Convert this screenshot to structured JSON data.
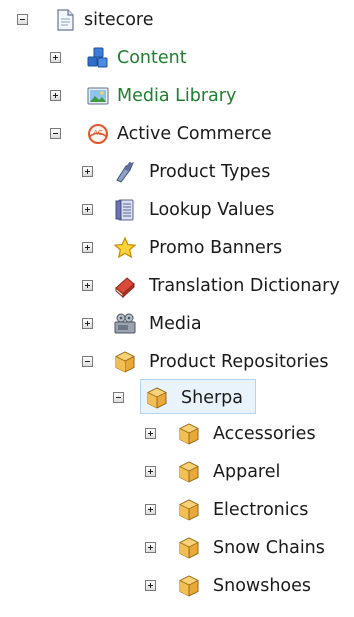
{
  "tree": {
    "root": {
      "label": "sitecore",
      "icon": "document-icon"
    },
    "items": [
      {
        "label": "Content",
        "icon": "content-icon",
        "state": "collapsed",
        "color": "#1f7f2e"
      },
      {
        "label": "Media Library",
        "icon": "media-library-icon",
        "state": "collapsed",
        "color": "#1f7f2e"
      },
      {
        "label": "Active Commerce",
        "icon": "active-commerce-icon",
        "state": "expanded"
      },
      {
        "label": "Product Types",
        "icon": "product-types-icon",
        "state": "collapsed"
      },
      {
        "label": "Lookup Values",
        "icon": "lookup-values-icon",
        "state": "collapsed"
      },
      {
        "label": "Promo Banners",
        "icon": "star-icon",
        "state": "collapsed"
      },
      {
        "label": "Translation Dictionary",
        "icon": "dictionary-book-icon",
        "state": "collapsed"
      },
      {
        "label": "Media",
        "icon": "media-icon",
        "state": "collapsed"
      },
      {
        "label": "Product Repositories",
        "icon": "box-icon",
        "state": "expanded"
      },
      {
        "label": "Sherpa",
        "icon": "box-icon",
        "state": "expanded",
        "selected": true
      },
      {
        "label": "Accessories",
        "icon": "box-icon",
        "state": "collapsed"
      },
      {
        "label": "Apparel",
        "icon": "box-icon",
        "state": "collapsed"
      },
      {
        "label": "Electronics",
        "icon": "box-icon",
        "state": "collapsed"
      },
      {
        "label": "Snow Chains",
        "icon": "box-icon",
        "state": "collapsed"
      },
      {
        "label": "Snowshoes",
        "icon": "box-icon",
        "state": "collapsed"
      }
    ]
  },
  "colors": {
    "link_green": "#1f7f2e",
    "selection_bg": "#e8f3fb",
    "selection_border": "#b4d5ef"
  }
}
